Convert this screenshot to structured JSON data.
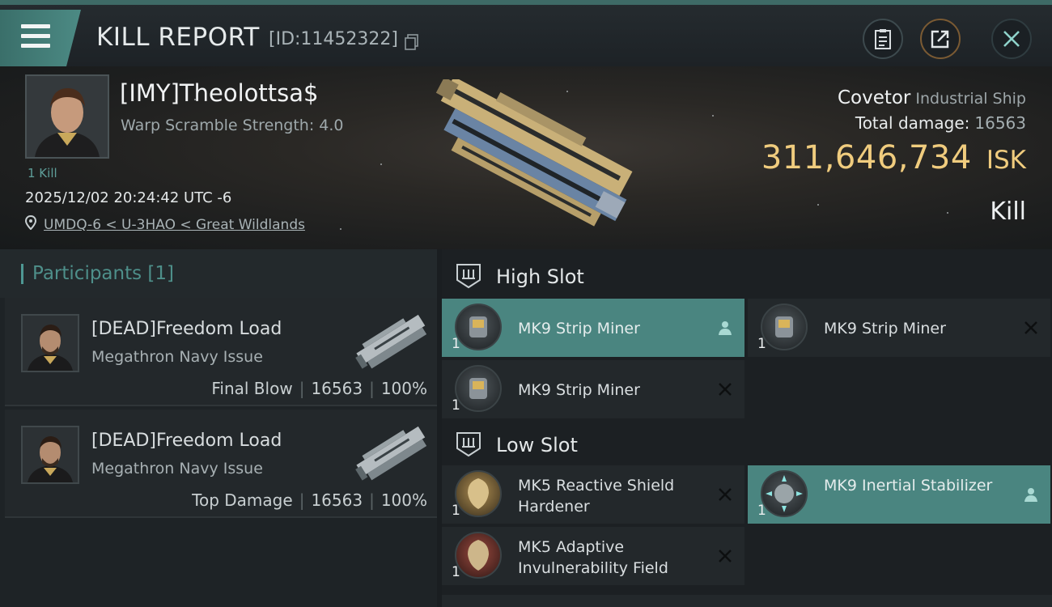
{
  "header": {
    "title": "KILL REPORT",
    "report_id": "[ID:11452322]",
    "icons": [
      "menu-icon",
      "copy-icon",
      "clipboard-icon",
      "share-icon",
      "close-icon"
    ]
  },
  "victim": {
    "name": "[IMY]Theolottsa$",
    "warp_scramble": "Warp Scramble Strength: 4.0",
    "kills": "1 Kill",
    "datetime": "2025/12/02 20:24:42 UTC -6",
    "location": "UMDQ-6 < U-3HAO < Great Wildlands",
    "ship_name": "Covetor",
    "ship_class": "Industrial Ship",
    "total_damage_label": "Total damage:",
    "total_damage": "16563",
    "isk_value": "311,646,734",
    "isk_unit": "ISK",
    "result": "Kill"
  },
  "participants": {
    "header": "Participants [1]",
    "items": [
      {
        "name": "[DEAD]Freedom Load",
        "ship": "Megathron Navy Issue",
        "role": "Final Blow",
        "damage": "16563",
        "percent": "100%"
      },
      {
        "name": "[DEAD]Freedom Load",
        "ship": "Megathron Navy Issue",
        "role": "Top Damage",
        "damage": "16563",
        "percent": "100%"
      }
    ]
  },
  "fitting": {
    "high_slot": {
      "label": "High Slot",
      "modules": [
        {
          "name": "MK9 Strip Miner",
          "qty": "1",
          "status": "user-icon"
        },
        {
          "name": "MK9 Strip Miner",
          "qty": "1",
          "status": "destroyed-icon"
        },
        {
          "name": "MK9 Strip Miner",
          "qty": "1",
          "status": "destroyed-icon"
        }
      ]
    },
    "low_slot": {
      "label": "Low Slot",
      "modules": [
        {
          "name": "MK5 Reactive Shield Hardener",
          "qty": "1",
          "status": "destroyed-icon"
        },
        {
          "name": "MK9 Inertial Stabilizer",
          "qty": "1",
          "status": "user-icon"
        },
        {
          "name": "MK5 Adaptive Invulnerability Field",
          "qty": "1",
          "status": "destroyed-icon"
        }
      ]
    }
  }
}
